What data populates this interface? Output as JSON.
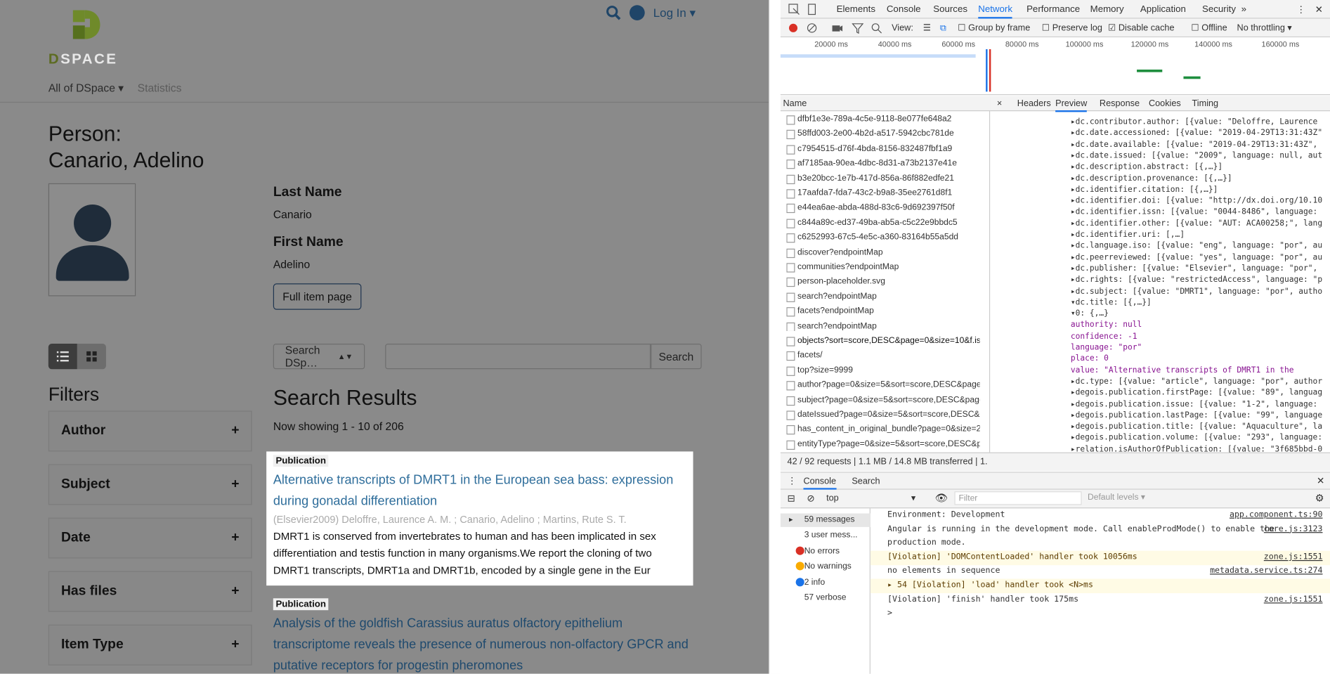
{
  "page": {
    "logo_text": "SPACE",
    "logo_d": "D",
    "login": "Log In ▾",
    "nav": {
      "all": "All of DSpace ▾",
      "stats": "Statistics"
    },
    "title": "Person:\nCanario, Adelino",
    "last_name_label": "Last Name",
    "last_name": "Canario",
    "first_name_label": "First Name",
    "first_name": "Adelino",
    "full_item": "Full item page",
    "filters": "Filters",
    "facets": [
      "Author",
      "Subject",
      "Date",
      "Has files",
      "Item Type"
    ],
    "search_select": "Search DSp…",
    "search_btn": "Search",
    "results_title": "Search Results",
    "showing": "Now showing 1 - 10 of 206",
    "results": [
      {
        "badge": "Publication",
        "title": "Alternative transcripts of DMRT1 in the European sea bass: expression during gonadal differentiation",
        "meta": "(Elsevier2009) Deloffre, Laurence A. M. ; Canario, Adelino ; Martins, Rute S. T.",
        "abstract": "DMRT1 is conserved from invertebrates to human and has been implicated in sex differentiation and testis function in many organisms.We report the cloning of two DMRT1 transcripts, DMRT1a and DMRT1b, encoded by a single gene in the Eur"
      },
      {
        "badge": "Publication",
        "title": "Analysis of the goldfish Carassius auratus olfactory epithelium transcriptome reveals the presence of numerous non-olfactory GPCR and putative receptors for progestin pheromones"
      }
    ]
  },
  "devtools": {
    "tabs": [
      "Elements",
      "Console",
      "Sources",
      "Network",
      "Performance",
      "Memory",
      "Application",
      "Security",
      "»"
    ],
    "toolbar": {
      "view": "View:",
      "group": "Group by frame",
      "preserve": "Preserve log",
      "disable": "Disable cache",
      "offline": "Offline",
      "throttle": "No throttling"
    },
    "ticks": [
      "20000 ms",
      "40000 ms",
      "60000 ms",
      "80000 ms",
      "100000 ms",
      "120000 ms",
      "140000 ms",
      "160000 ms"
    ],
    "name_header": "Name",
    "requests": [
      "dfbf1e3e-789a-4c5e-9118-8e077fe648a2",
      "58ffd003-2e00-4b2d-a517-5942cbc781de",
      "c7954515-d76f-4bda-8156-832487fbf1a9",
      "af7185aa-90ea-4dbc-8d31-a73b2137e41e",
      "b3e20bcc-1e7b-417d-856a-86f882edfe21",
      "17aafda7-fda7-43c2-b9a8-35ee2761d8f1",
      "e44ea6ae-abda-488d-83c6-9d692397f50f",
      "c844a89c-ed37-49ba-ab5a-c5c22e9bbdc5",
      "c6252993-67c5-4e5c-a360-83164b55a5dd",
      "discover?endpointMap",
      "communities?endpointMap",
      "person-placeholder.svg",
      "search?endpointMap",
      "facets?endpointMap",
      "search?endpointMap",
      "objects?sort=score,DESC&page=0&size=10&f.is...",
      "facets/",
      "top?size=9999",
      "author?page=0&size=5&sort=score,DESC&page",
      "subject?page=0&size=5&sort=score,DESC&page",
      "dateIssued?page=0&size=5&sort=score,DESC&p",
      "has_content_in_original_bundle?page=0&size=2",
      "entityType?page=0&size=5&sort=score,DESC&p"
    ],
    "preview_tabs": [
      "×",
      "Headers",
      "Preview",
      "Response",
      "Cookies",
      "Timing"
    ],
    "json_lines": [
      "▸dc.contributor.author: [{value: \"Deloffre, Laurence",
      "▸dc.date.accessioned: [{value: \"2019-04-29T13:31:43Z\"",
      "▸dc.date.available: [{value: \"2019-04-29T13:31:43Z\",",
      "▸dc.date.issued: [{value: \"2009\", language: null, aut",
      "▸dc.description.abstract: [{,…}]",
      "▸dc.description.provenance: [{,…}]",
      "▸dc.identifier.citation: [{,…}]",
      "▸dc.identifier.doi: [{value: \"http://dx.doi.org/10.10",
      "▸dc.identifier.issn: [{value: \"0044-8486\", language:",
      "▸dc.identifier.other: [{value: \"AUT: ACA00258;\", lang",
      "▸dc.identifier.uri: [,…]",
      "▸dc.language.iso: [{value: \"eng\", language: \"por\", au",
      "▸dc.peerreviewed: [{value: \"yes\", language: \"por\", au",
      "▸dc.publisher: [{value: \"Elsevier\", language: \"por\",",
      "▸dc.rights: [{value: \"restrictedAccess\", language: \"p",
      "▸dc.subject: [{value: \"DMRT1\", language: \"por\", autho",
      "▾dc.title: [{,…}]",
      "  ▾0: {,…}",
      "     authority: null",
      "     confidence: -1",
      "     language: \"por\"",
      "     place: 0",
      "     value: \"Alternative transcripts of DMRT1 in the",
      "▸dc.type: [{value: \"article\", language: \"por\", author",
      "▸degois.publication.firstPage: [{value: \"89\", languag",
      "▸degois.publication.issue: [{value: \"1-2\", language:",
      "▸degois.publication.lastPage: [{value: \"99\", language",
      "▸degois.publication.title: [{value: \"Aquaculture\", la",
      "▸degois.publication.volume: [{value: \"293\", language:",
      "▸relation.isAuthorOfPublication: [{value: \"3f685bbd-0"
    ],
    "status": "42 / 92 requests  |  1.1 MB / 14.8 MB transferred  |  1.",
    "console_tabs": [
      "Console",
      "Search"
    ],
    "context": "top",
    "filter": "Filter",
    "levels": "Default levels ▾",
    "side": [
      "59 messages",
      "3 user mess...",
      "No errors",
      "No warnings",
      "2 info",
      "57 verbose"
    ],
    "messages": [
      {
        "text": "Environment: Development",
        "src": "app.component.ts:90",
        "warn": false
      },
      {
        "text": "Angular is running in the development mode. Call enableProdMode() to enable the",
        "src": "core.js:3123",
        "warn": false
      },
      {
        "text": "production mode.",
        "src": "",
        "warn": false
      },
      {
        "text": "[Violation] 'DOMContentLoaded' handler took 10056ms",
        "src": "zone.js:1551",
        "warn": true
      },
      {
        "text": "no elements in sequence",
        "src": "metadata.service.ts:274",
        "warn": false
      },
      {
        "text": "▸ 54  [Violation] 'load' handler took <N>ms",
        "src": "",
        "warn": true
      },
      {
        "text": "[Violation] 'finish' handler took 175ms",
        "src": "zone.js:1551",
        "warn": false
      },
      {
        "text": ">",
        "src": "",
        "warn": false
      }
    ]
  }
}
